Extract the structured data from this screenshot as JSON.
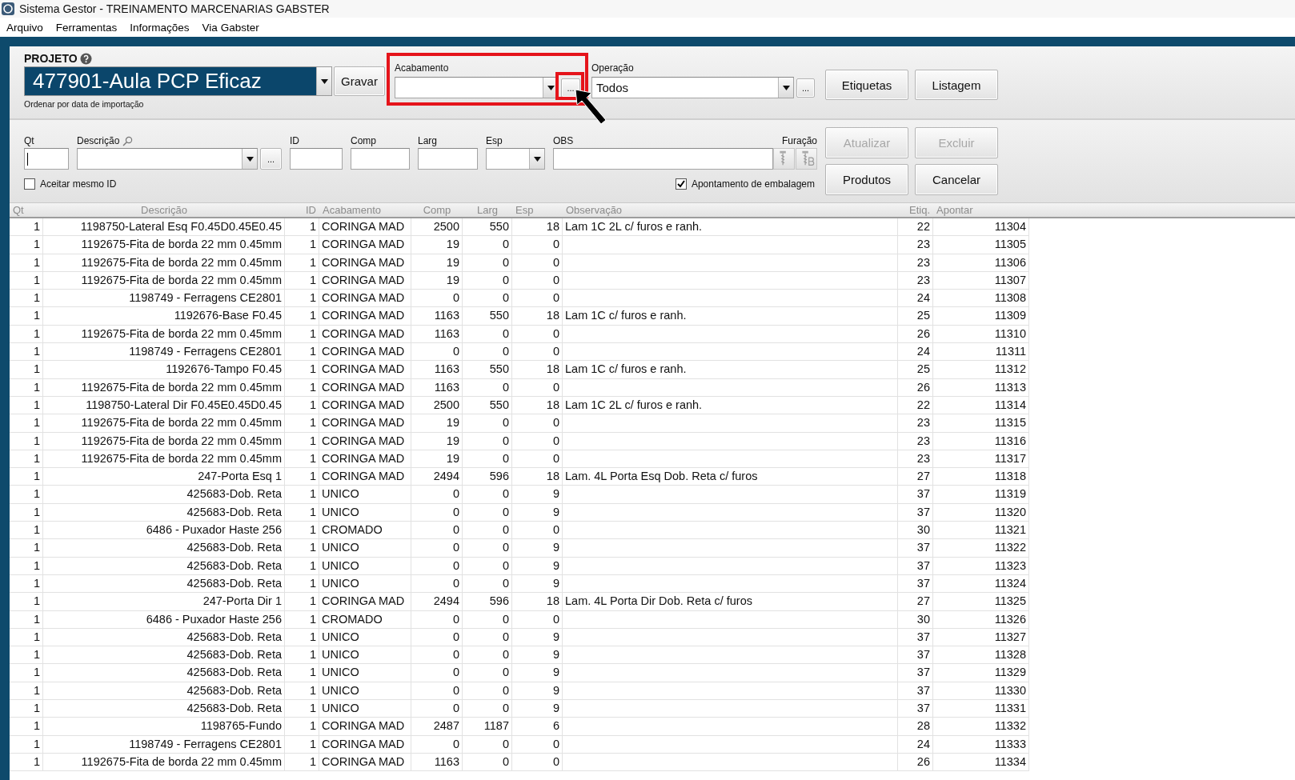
{
  "window": {
    "title": "Sistema Gestor - TREINAMENTO MARCENARIAS GABSTER"
  },
  "menu": [
    "Arquivo",
    "Ferramentas",
    "Informações",
    "Via Gabster"
  ],
  "projeto": {
    "label": "PROJETO",
    "value": "477901-Aula PCP Eficaz",
    "save_button": "Gravar",
    "sort_note": "Ordenar por data de importação"
  },
  "acabamento": {
    "label": "Acabamento",
    "more_button": "...",
    "highlighted": true
  },
  "operacao": {
    "label": "Operação",
    "value": "Todos",
    "more_button": "..."
  },
  "top_buttons": [
    {
      "label": "Etiquetas",
      "disabled": false
    },
    {
      "label": "Listagem",
      "disabled": false
    }
  ],
  "form": {
    "fields": [
      {
        "kind": "input",
        "label": "Qt"
      },
      {
        "kind": "combo",
        "label": "Descrição",
        "more_button": "..."
      },
      {
        "kind": "input",
        "label": "ID"
      },
      {
        "kind": "input",
        "label": "Comp"
      },
      {
        "kind": "input",
        "label": "Larg"
      },
      {
        "kind": "select",
        "label": "Esp"
      },
      {
        "kind": "input",
        "label": "OBS"
      },
      {
        "kind": "drills",
        "label": "Furação"
      }
    ],
    "checkboxes": [
      {
        "label": "Aceitar mesmo ID",
        "checked": false
      },
      {
        "label": "Apontamento de embalagem",
        "checked": true
      }
    ],
    "buttons": [
      {
        "label": "Atualizar",
        "disabled": true
      },
      {
        "label": "Excluir",
        "disabled": true
      },
      {
        "label": "Produtos",
        "disabled": false
      },
      {
        "label": "Cancelar",
        "disabled": false
      }
    ]
  },
  "table": {
    "columns": [
      "Qt",
      "Descrição",
      "ID",
      "Acabamento",
      "Comp",
      "Larg",
      "Esp",
      "Observação",
      "Etiq.",
      "Apontar"
    ],
    "rows": [
      [
        "1",
        "1198750-Lateral Esq F0.45D0.45E0.45",
        "1",
        "CORINGA MAD",
        "2500",
        "550",
        "18",
        "Lam 1C 2L c/ furos e ranh.",
        "22",
        "11304"
      ],
      [
        "1",
        "1192675-Fita de borda 22 mm 0.45mm",
        "1",
        "CORINGA MAD",
        "19",
        "0",
        "0",
        null,
        "23",
        "11305"
      ],
      [
        "1",
        "1192675-Fita de borda 22 mm 0.45mm",
        "1",
        "CORINGA MAD",
        "19",
        "0",
        "0",
        null,
        "23",
        "11306"
      ],
      [
        "1",
        "1192675-Fita de borda 22 mm 0.45mm",
        "1",
        "CORINGA MAD",
        "19",
        "0",
        "0",
        null,
        "23",
        "11307"
      ],
      [
        "1",
        "1198749 - Ferragens CE2801",
        "1",
        "CORINGA MAD",
        "0",
        "0",
        "0",
        null,
        "24",
        "11308"
      ],
      [
        "1",
        "1192676-Base F0.45",
        "1",
        "CORINGA MAD",
        "1163",
        "550",
        "18",
        "Lam 1C c/ furos e ranh.",
        "25",
        "11309"
      ],
      [
        "1",
        "1192675-Fita de borda 22 mm 0.45mm",
        "1",
        "CORINGA MAD",
        "1163",
        "0",
        "0",
        null,
        "26",
        "11310"
      ],
      [
        "1",
        "1198749 - Ferragens CE2801",
        "1",
        "CORINGA MAD",
        "0",
        "0",
        "0",
        null,
        "24",
        "11311"
      ],
      [
        "1",
        "1192676-Tampo F0.45",
        "1",
        "CORINGA MAD",
        "1163",
        "550",
        "18",
        "Lam 1C c/ furos e ranh.",
        "25",
        "11312"
      ],
      [
        "1",
        "1192675-Fita de borda 22 mm 0.45mm",
        "1",
        "CORINGA MAD",
        "1163",
        "0",
        "0",
        null,
        "26",
        "11313"
      ],
      [
        "1",
        "1198750-Lateral Dir F0.45E0.45D0.45",
        "1",
        "CORINGA MAD",
        "2500",
        "550",
        "18",
        "Lam 1C 2L c/ furos e ranh.",
        "22",
        "11314"
      ],
      [
        "1",
        "1192675-Fita de borda 22 mm 0.45mm",
        "1",
        "CORINGA MAD",
        "19",
        "0",
        "0",
        null,
        "23",
        "11315"
      ],
      [
        "1",
        "1192675-Fita de borda 22 mm 0.45mm",
        "1",
        "CORINGA MAD",
        "19",
        "0",
        "0",
        null,
        "23",
        "11316"
      ],
      [
        "1",
        "1192675-Fita de borda 22 mm 0.45mm",
        "1",
        "CORINGA MAD",
        "19",
        "0",
        "0",
        null,
        "23",
        "11317"
      ],
      [
        "1",
        "247-Porta Esq 1",
        "1",
        "CORINGA MAD",
        "2494",
        "596",
        "18",
        "Lam. 4L Porta Esq Dob. Reta c/ furos",
        "27",
        "11318"
      ],
      [
        "1",
        "425683-Dob. Reta",
        "1",
        "UNICO",
        "0",
        "0",
        "9",
        null,
        "37",
        "11319"
      ],
      [
        "1",
        "425683-Dob. Reta",
        "1",
        "UNICO",
        "0",
        "0",
        "9",
        null,
        "37",
        "11320"
      ],
      [
        "1",
        "6486 - Puxador Haste 256",
        "1",
        "CROMADO",
        "0",
        "0",
        "0",
        null,
        "30",
        "11321"
      ],
      [
        "1",
        "425683-Dob. Reta",
        "1",
        "UNICO",
        "0",
        "0",
        "9",
        null,
        "37",
        "11322"
      ],
      [
        "1",
        "425683-Dob. Reta",
        "1",
        "UNICO",
        "0",
        "0",
        "9",
        null,
        "37",
        "11323"
      ],
      [
        "1",
        "425683-Dob. Reta",
        "1",
        "UNICO",
        "0",
        "0",
        "9",
        null,
        "37",
        "11324"
      ],
      [
        "1",
        "247-Porta Dir 1",
        "1",
        "CORINGA MAD",
        "2494",
        "596",
        "18",
        "Lam. 4L Porta Dir Dob. Reta c/ furos",
        "27",
        "11325"
      ],
      [
        "1",
        "6486 - Puxador Haste 256",
        "1",
        "CROMADO",
        "0",
        "0",
        "0",
        null,
        "30",
        "11326"
      ],
      [
        "1",
        "425683-Dob. Reta",
        "1",
        "UNICO",
        "0",
        "0",
        "9",
        null,
        "37",
        "11327"
      ],
      [
        "1",
        "425683-Dob. Reta",
        "1",
        "UNICO",
        "0",
        "0",
        "9",
        null,
        "37",
        "11328"
      ],
      [
        "1",
        "425683-Dob. Reta",
        "1",
        "UNICO",
        "0",
        "0",
        "9",
        null,
        "37",
        "11329"
      ],
      [
        "1",
        "425683-Dob. Reta",
        "1",
        "UNICO",
        "0",
        "0",
        "9",
        null,
        "37",
        "11330"
      ],
      [
        "1",
        "425683-Dob. Reta",
        "1",
        "UNICO",
        "0",
        "0",
        "9",
        null,
        "37",
        "11331"
      ],
      [
        "1",
        "1198765-Fundo",
        "1",
        "CORINGA MAD",
        "2487",
        "1187",
        "6",
        null,
        "28",
        "11332"
      ],
      [
        "1",
        "1198749 - Ferragens CE2801",
        "1",
        "CORINGA MAD",
        "0",
        "0",
        "0",
        null,
        "24",
        "11333"
      ],
      [
        "1",
        "1192675-Fita de borda 22 mm 0.45mm",
        "1",
        "CORINGA MAD",
        "1163",
        "0",
        "0",
        null,
        "26",
        "11334"
      ]
    ]
  }
}
